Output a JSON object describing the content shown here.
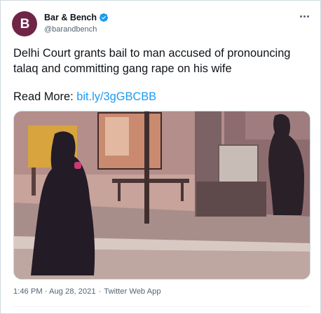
{
  "tweet": {
    "display_name": "Bar & Bench",
    "handle": "@barandbench",
    "avatar_letter": "B",
    "brand_color": "#6f2546",
    "verified_color": "#1d9bf0",
    "text": "Delhi Court grants bail to man accused of pronouncing talaq and committing gang rape on his wife",
    "read_more_label": "Read More:",
    "link_text": "bit.ly/3gGBCBB",
    "timestamp": "1:46 PM · Aug 28, 2021",
    "separator": "·",
    "source": "Twitter Web App",
    "more_icon": "more-horizontal-icon"
  }
}
